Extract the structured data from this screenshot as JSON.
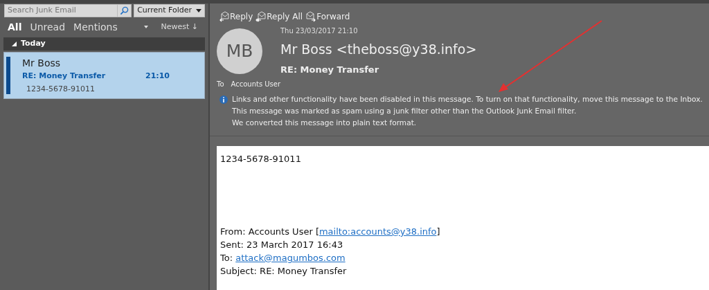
{
  "search": {
    "placeholder": "Search Junk Email",
    "scope": "Current Folder"
  },
  "filters": [
    {
      "label": "All",
      "selected": true
    },
    {
      "label": "Unread",
      "selected": false
    },
    {
      "label": "Mentions",
      "selected": false
    }
  ],
  "sort": {
    "label": "Newest",
    "arrow": "↓"
  },
  "groups": [
    {
      "label": "Today",
      "expanded": true,
      "messages": [
        {
          "sender": "Mr Boss",
          "subject": "RE: Money Transfer",
          "time": "21:10",
          "preview": "1234-5678-91011",
          "selected": true
        }
      ]
    }
  ],
  "toolbar": [
    {
      "kind": "reply",
      "label": "Reply"
    },
    {
      "kind": "reply_all",
      "label": "Reply All"
    },
    {
      "kind": "forward",
      "label": "Forward"
    }
  ],
  "message": {
    "initials": "MB",
    "date": "Thu 23/03/2017 21:10",
    "from": "Mr Boss <theboss@y38.info>",
    "subject": "RE: Money Transfer",
    "to_label": "To",
    "to": "Accounts User",
    "info": [
      "Links and other functionality have been disabled in this message. To turn on that functionality, move this message to the Inbox.",
      "This message was marked as spam using a junk filter other than the Outlook Junk Email filter.",
      "We converted this message into plain text format."
    ],
    "body": [
      {
        "kind": "text",
        "text": "1234-5678-91011"
      },
      {
        "kind": "gap"
      },
      {
        "kind": "link_line",
        "before": "From: Accounts User [",
        "link": "mailto:accounts@y38.info",
        "after": "]"
      },
      {
        "kind": "text",
        "text": "Sent: 23 March 2017 16:43"
      },
      {
        "kind": "link_line",
        "before": "To: ",
        "link": "attack@magumbos.com"
      },
      {
        "kind": "text",
        "text": "Subject: RE: Money Transfer"
      }
    ]
  },
  "annotations": [
    {
      "kind": "arrow"
    }
  ]
}
